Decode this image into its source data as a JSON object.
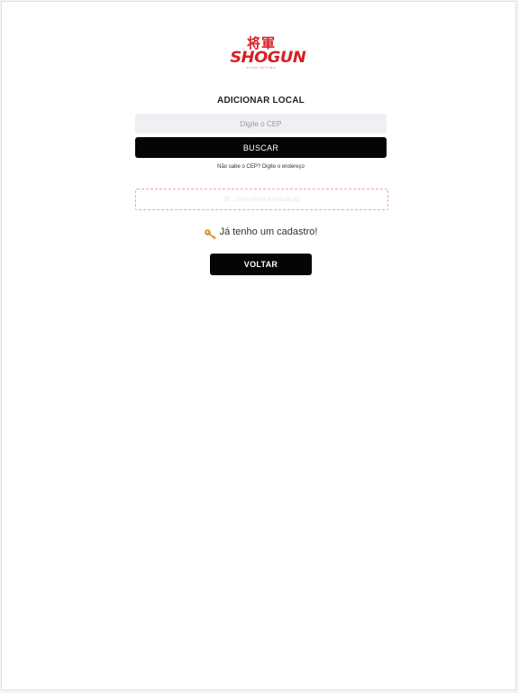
{
  "brand": {
    "kanji": "将軍",
    "name": "SHOGUN",
    "tagline": "SUSHI BISTRO",
    "color": "#d81f26"
  },
  "form": {
    "title": "ADICIONAR LOCAL",
    "cep_placeholder": "Digite o CEP",
    "cep_value": "",
    "search_button": "BUSCAR",
    "help_link": "Não sabe o CEP? Digite o endereço"
  },
  "location": {
    "icon": "location-icon",
    "label": "Usar minha localização",
    "border_color": "#f0a6ae"
  },
  "account": {
    "icon": "key-icon",
    "login_text": "Já tenho um cadastro!"
  },
  "actions": {
    "back_button": "VOLTAR"
  }
}
